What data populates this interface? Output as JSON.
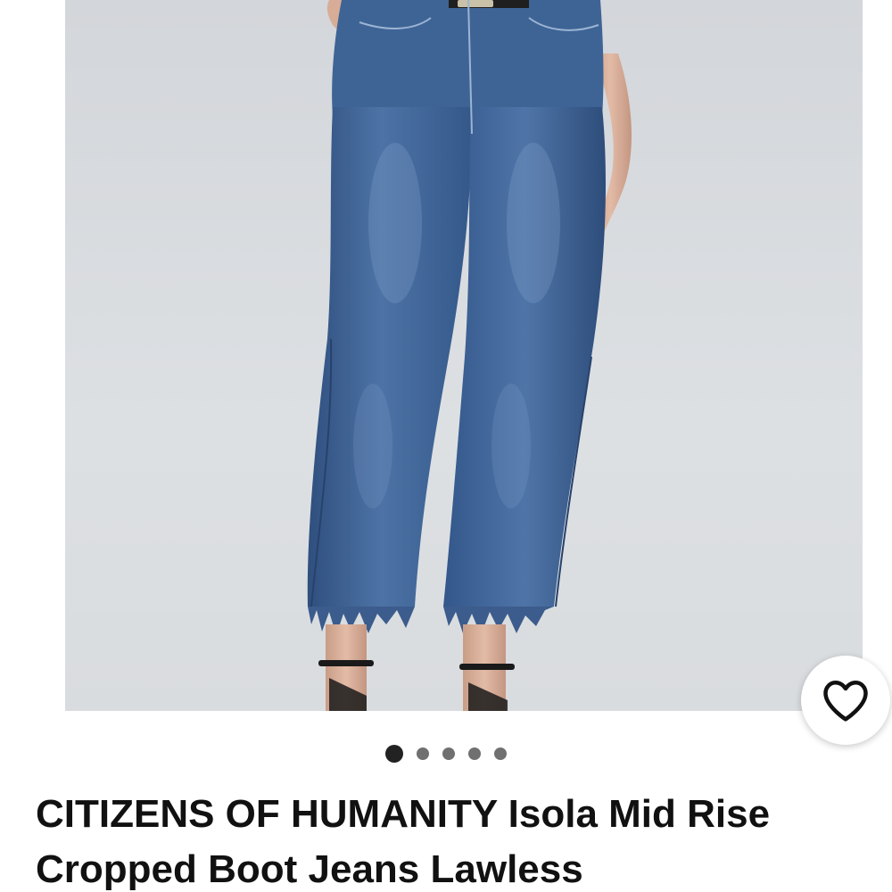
{
  "listing": {
    "brand": "CITIZENS OF HUMANITY",
    "title_rest": " Isola Mid Rise Cropped Boot Jeans Lawless"
  },
  "gallery": {
    "image_subject": "model wearing cropped boot jeans",
    "dots_count": 5,
    "active_index": 0
  },
  "icons": {
    "favorite": "heart-outline-icon"
  },
  "colors": {
    "background": "#ffffff",
    "image_background": "#d9dcdf",
    "denim": "#3c5e8f",
    "active_dot": "#222222",
    "inactive_dot": "#707070"
  }
}
